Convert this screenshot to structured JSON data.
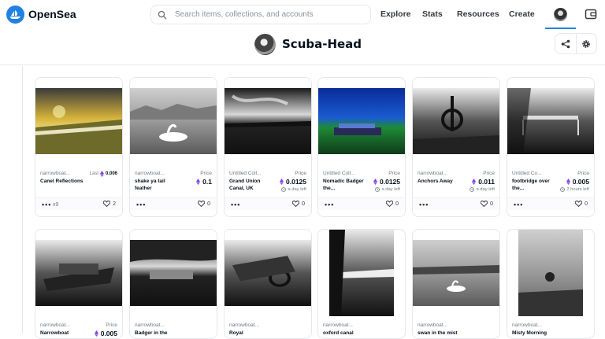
{
  "header": {
    "brand": "OpenSea",
    "search_placeholder": "Search items, collections, and accounts",
    "nav": [
      "Explore",
      "Stats",
      "Resources",
      "Create"
    ]
  },
  "profile": {
    "name": "Scuba-Head"
  },
  "colors": {
    "accent": "#2081e2",
    "eth_purple": "#8247e5"
  },
  "cards": [
    {
      "collection": "narrowboat...",
      "title": "Canel Reflections",
      "price_mode": "last",
      "last_label": "Last",
      "price": "0.006",
      "likes": "2",
      "extra": "x9"
    },
    {
      "collection": "narrowboat...",
      "title": "shake ya tail feather",
      "price_mode": "price",
      "price_label": "Price",
      "price": "0.1",
      "time": "",
      "likes": "0"
    },
    {
      "collection": "Untitled Coll...",
      "title": "Grand Union Canal, UK",
      "price_mode": "price",
      "price_label": "Price",
      "price": "0.0125",
      "time": "a day left",
      "likes": "0"
    },
    {
      "collection": "Untitled Coll...",
      "title": "Nomadic Badger the...",
      "price_mode": "price",
      "price_label": "Price",
      "price": "0.0125",
      "time": "a day left",
      "likes": "0"
    },
    {
      "collection": "narrowboat...",
      "title": "Anchors Away",
      "price_mode": "price",
      "price_label": "Price",
      "price": "0.011",
      "time": "a day left",
      "likes": "0"
    },
    {
      "collection": "Untitled Co...",
      "title": "footbridge over the...",
      "price_mode": "price",
      "price_label": "Price",
      "price": "0.005",
      "time": "2 hours left",
      "likes": "0"
    },
    {
      "collection": "narrowboat...",
      "title": "Narrowboat",
      "price_label": "Price",
      "price": "0.005"
    },
    {
      "collection": "narrowboat...",
      "title": "Badger in the"
    },
    {
      "collection": "narrowboat...",
      "title": "Royal"
    },
    {
      "collection": "narrowboat...",
      "title": "oxford canal"
    },
    {
      "collection": "narrowboat...",
      "title": "swan in the mist"
    },
    {
      "collection": "narrowboat...",
      "title": "Misty Morning"
    }
  ]
}
